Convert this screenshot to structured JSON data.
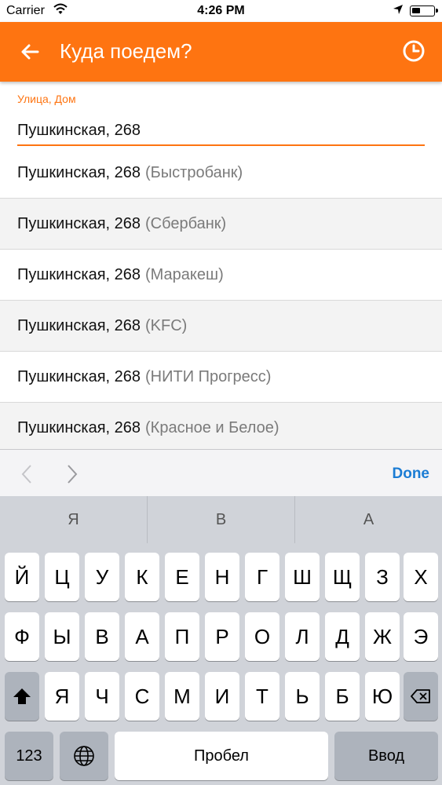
{
  "status_bar": {
    "carrier": "Carrier",
    "time": "4:26 PM"
  },
  "app_bar": {
    "title": "Куда поедем?",
    "back_icon": "arrow-left-icon",
    "history_icon": "clock-icon",
    "color": "#fe7411"
  },
  "address_field": {
    "label": "Улица, Дом",
    "value": "Пушкинская, 268"
  },
  "suggestions": [
    {
      "street": "Пушкинская, 268",
      "place": "(Быстробанк)"
    },
    {
      "street": "Пушкинская, 268",
      "place": "(Сбербанк)"
    },
    {
      "street": "Пушкинская, 268",
      "place": "(Маракеш)"
    },
    {
      "street": "Пушкинская, 268",
      "place": "(KFC)"
    },
    {
      "street": "Пушкинская, 268",
      "place": "(НИТИ Прогресс)"
    },
    {
      "street": "Пушкинская, 268",
      "place": "(Красное и Белое)"
    }
  ],
  "accessory": {
    "done": "Done"
  },
  "keyboard": {
    "predictions": [
      "Я",
      "В",
      "А"
    ],
    "row1": [
      "Й",
      "Ц",
      "У",
      "К",
      "Е",
      "Н",
      "Г",
      "Ш",
      "Щ",
      "З",
      "Х"
    ],
    "row2": [
      "Ф",
      "Ы",
      "В",
      "А",
      "П",
      "Р",
      "О",
      "Л",
      "Д",
      "Ж",
      "Э"
    ],
    "row3": [
      "Я",
      "Ч",
      "С",
      "М",
      "И",
      "Т",
      "Ь",
      "Б",
      "Ю"
    ],
    "numbers_key": "123",
    "space_key": "Пробел",
    "return_key": "Ввод"
  }
}
